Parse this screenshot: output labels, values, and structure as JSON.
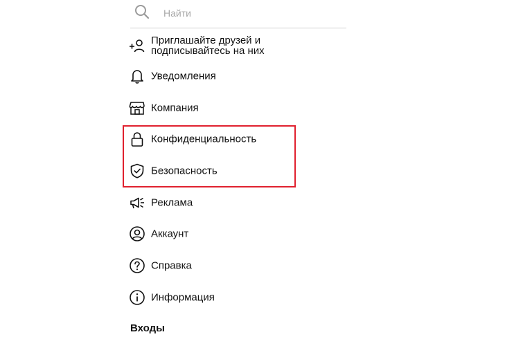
{
  "search": {
    "placeholder": "Найти",
    "icon": "search-icon"
  },
  "menu": {
    "items": [
      {
        "label": "Приглашайте друзей и подписывайтесь на них",
        "icon": "add-person-icon"
      },
      {
        "label": "Уведомления",
        "icon": "bell-icon"
      },
      {
        "label": "Компания",
        "icon": "storefront-icon"
      },
      {
        "label": "Конфиденциальность",
        "icon": "lock-icon"
      },
      {
        "label": "Безопасность",
        "icon": "shield-check-icon"
      },
      {
        "label": "Реклама",
        "icon": "megaphone-icon"
      },
      {
        "label": "Аккаунт",
        "icon": "account-circle-icon"
      },
      {
        "label": "Справка",
        "icon": "help-circle-icon"
      },
      {
        "label": "Информация",
        "icon": "info-circle-icon"
      }
    ]
  },
  "sections": {
    "logins_title": "Входы"
  },
  "colors": {
    "highlight": "#e0202e",
    "text": "#111111",
    "placeholder": "#a8a8a8"
  }
}
